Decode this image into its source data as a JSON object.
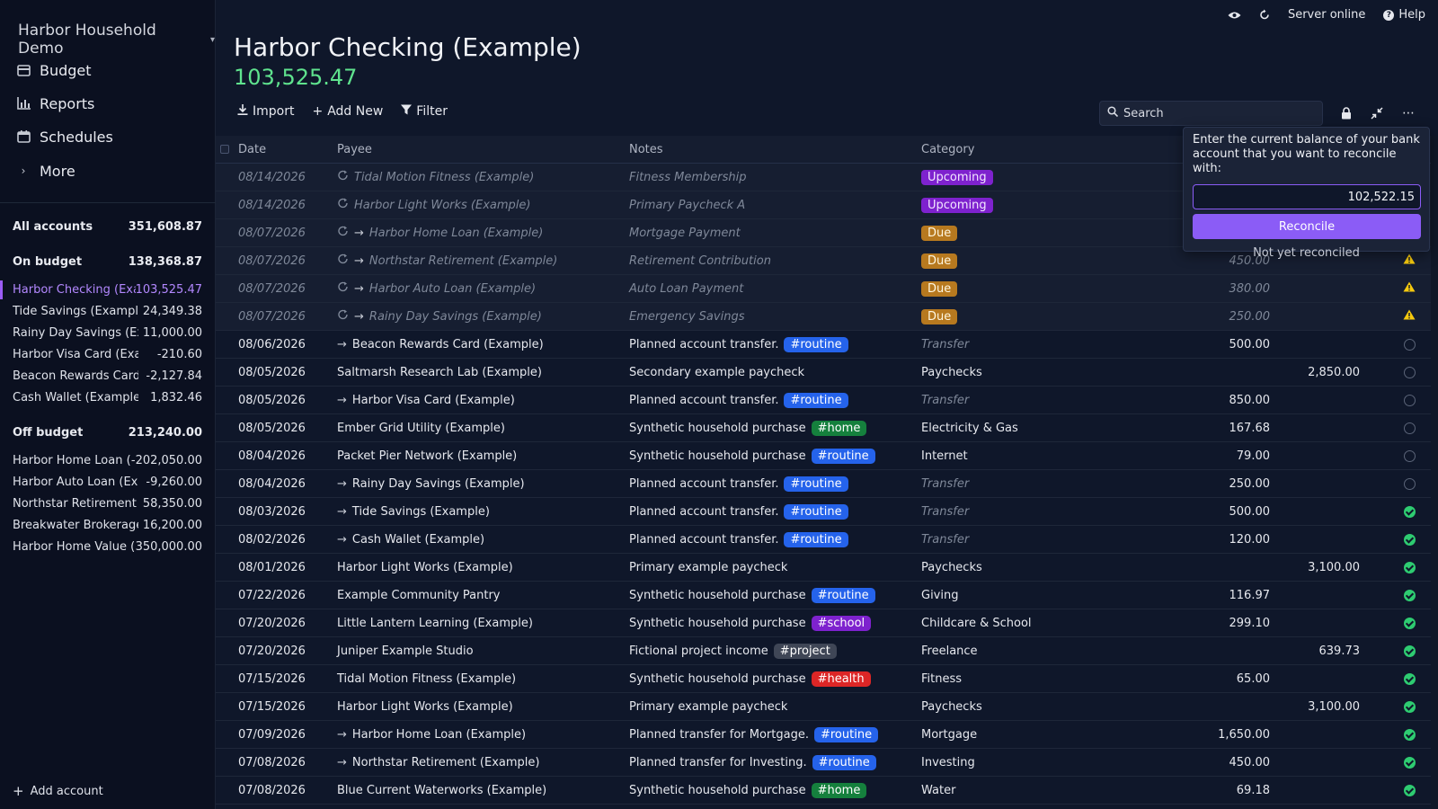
{
  "sidebar": {
    "budget_name": "Harbor Household Demo",
    "nav": [
      {
        "label": "Budget",
        "icon": "wallet-icon"
      },
      {
        "label": "Reports",
        "icon": "reports-icon"
      },
      {
        "label": "Schedules",
        "icon": "calendar-icon"
      },
      {
        "label": "More",
        "icon": "chevron-right-icon"
      }
    ],
    "all_accounts": {
      "label": "All accounts",
      "amount": "351,608.87"
    },
    "on_budget": {
      "label": "On budget",
      "amount": "138,368.87"
    },
    "on_budget_accounts": [
      {
        "name": "Harbor Checking (Example)",
        "amount": "103,525.47",
        "active": true
      },
      {
        "name": "Tide Savings (Example)",
        "amount": "24,349.38"
      },
      {
        "name": "Rainy Day Savings (Example)",
        "amount": "11,000.00"
      },
      {
        "name": "Harbor Visa Card (Example)",
        "amount": "-210.60"
      },
      {
        "name": "Beacon Rewards Card (Example)",
        "amount": "-2,127.84"
      },
      {
        "name": "Cash Wallet (Example)",
        "amount": "1,832.46"
      }
    ],
    "off_budget": {
      "label": "Off budget",
      "amount": "213,240.00"
    },
    "off_budget_accounts": [
      {
        "name": "Harbor Home Loan (Example)",
        "amount": "-202,050.00"
      },
      {
        "name": "Harbor Auto Loan (Example)",
        "amount": "-9,260.00"
      },
      {
        "name": "Northstar Retirement (Example)",
        "amount": "58,350.00"
      },
      {
        "name": "Breakwater Brokerage (Example)",
        "amount": "16,200.00"
      },
      {
        "name": "Harbor Home Value (Example)",
        "amount": "350,000.00"
      }
    ],
    "add_account": "Add account"
  },
  "topbar": {
    "server_status": "Server online",
    "help": "Help"
  },
  "account": {
    "title": "Harbor Checking (Example)",
    "balance": "103,525.47"
  },
  "toolbar": {
    "import": "Import",
    "add_new": "Add New",
    "filter": "Filter",
    "search_placeholder": "Search"
  },
  "columns": {
    "date": "Date",
    "payee": "Payee",
    "notes": "Notes",
    "category": "Category"
  },
  "colors": {
    "accent": "#8b5cf6",
    "balance_green": "#5fe38e",
    "upcoming": "#7e22ce",
    "due": "#b7791f",
    "cleared": "#2ecc71"
  },
  "transactions": [
    {
      "date": "08/14/2026",
      "payee": "Tidal Motion Fitness (Example)",
      "notes": "Fitness Membership",
      "status_badge": "Upcoming",
      "scheduled": true
    },
    {
      "date": "08/14/2026",
      "payee": "Harbor Light Works (Example)",
      "notes": "Primary Paycheck A",
      "status_badge": "Upcoming",
      "scheduled": true
    },
    {
      "date": "08/07/2026",
      "payee": "Harbor Home Loan (Example)",
      "transfer": true,
      "notes": "Mortgage Payment",
      "status_badge": "Due",
      "scheduled": true
    },
    {
      "date": "08/07/2026",
      "payee": "Northstar Retirement (Example)",
      "transfer": true,
      "notes": "Retirement Contribution",
      "status_badge": "Due",
      "payment": "450.00",
      "scheduled": true,
      "warn": true
    },
    {
      "date": "08/07/2026",
      "payee": "Harbor Auto Loan (Example)",
      "transfer": true,
      "notes": "Auto Loan Payment",
      "status_badge": "Due",
      "payment": "380.00",
      "scheduled": true,
      "warn": true
    },
    {
      "date": "08/07/2026",
      "payee": "Rainy Day Savings (Example)",
      "transfer": true,
      "notes": "Emergency Savings",
      "status_badge": "Due",
      "payment": "250.00",
      "scheduled": true,
      "warn": true
    },
    {
      "date": "08/06/2026",
      "payee": "Beacon Rewards Card (Example)",
      "transfer": true,
      "notes": "Planned account transfer.",
      "tag": "#routine",
      "category": "Transfer",
      "payment": "500.00",
      "status": "pending"
    },
    {
      "date": "08/05/2026",
      "payee": "Saltmarsh Research Lab (Example)",
      "notes": "Secondary example paycheck",
      "category": "Paychecks",
      "deposit": "2,850.00",
      "status": "pending"
    },
    {
      "date": "08/05/2026",
      "payee": "Harbor Visa Card (Example)",
      "transfer": true,
      "notes": "Planned account transfer.",
      "tag": "#routine",
      "category": "Transfer",
      "payment": "850.00",
      "status": "pending"
    },
    {
      "date": "08/05/2026",
      "payee": "Ember Grid Utility (Example)",
      "notes": "Synthetic household purchase",
      "tag": "#home",
      "category": "Electricity & Gas",
      "payment": "167.68",
      "status": "pending"
    },
    {
      "date": "08/04/2026",
      "payee": "Packet Pier Network (Example)",
      "notes": "Synthetic household purchase",
      "tag": "#routine",
      "category": "Internet",
      "payment": "79.00",
      "status": "pending"
    },
    {
      "date": "08/04/2026",
      "payee": "Rainy Day Savings (Example)",
      "transfer": true,
      "notes": "Planned account transfer.",
      "tag": "#routine",
      "category": "Transfer",
      "payment": "250.00",
      "status": "pending"
    },
    {
      "date": "08/03/2026",
      "payee": "Tide Savings (Example)",
      "transfer": true,
      "notes": "Planned account transfer.",
      "tag": "#routine",
      "category": "Transfer",
      "payment": "500.00",
      "status": "cleared"
    },
    {
      "date": "08/02/2026",
      "payee": "Cash Wallet (Example)",
      "transfer": true,
      "notes": "Planned account transfer.",
      "tag": "#routine",
      "category": "Transfer",
      "payment": "120.00",
      "status": "cleared"
    },
    {
      "date": "08/01/2026",
      "payee": "Harbor Light Works (Example)",
      "notes": "Primary example paycheck",
      "category": "Paychecks",
      "deposit": "3,100.00",
      "status": "cleared"
    },
    {
      "date": "07/22/2026",
      "payee": "Example Community Pantry",
      "notes": "Synthetic household purchase",
      "tag": "#routine",
      "category": "Giving",
      "payment": "116.97",
      "status": "cleared"
    },
    {
      "date": "07/20/2026",
      "payee": "Little Lantern Learning (Example)",
      "notes": "Synthetic household purchase",
      "tag": "#school",
      "category": "Childcare & School",
      "payment": "299.10",
      "status": "cleared"
    },
    {
      "date": "07/20/2026",
      "payee": "Juniper Example Studio",
      "notes": "Fictional project income",
      "tag": "#project",
      "category": "Freelance",
      "deposit": "639.73",
      "status": "cleared"
    },
    {
      "date": "07/15/2026",
      "payee": "Tidal Motion Fitness (Example)",
      "notes": "Synthetic household purchase",
      "tag": "#health",
      "category": "Fitness",
      "payment": "65.00",
      "status": "cleared"
    },
    {
      "date": "07/15/2026",
      "payee": "Harbor Light Works (Example)",
      "notes": "Primary example paycheck",
      "category": "Paychecks",
      "deposit": "3,100.00",
      "status": "cleared"
    },
    {
      "date": "07/09/2026",
      "payee": "Harbor Home Loan (Example)",
      "transfer": true,
      "notes": "Planned transfer for Mortgage.",
      "tag": "#routine",
      "category": "Mortgage",
      "payment": "1,650.00",
      "status": "cleared"
    },
    {
      "date": "07/08/2026",
      "payee": "Northstar Retirement (Example)",
      "transfer": true,
      "notes": "Planned transfer for Investing.",
      "tag": "#routine",
      "category": "Investing",
      "payment": "450.00",
      "status": "cleared"
    },
    {
      "date": "07/08/2026",
      "payee": "Blue Current Waterworks (Example)",
      "notes": "Synthetic household purchase",
      "tag": "#home",
      "category": "Water",
      "payment": "69.18",
      "status": "cleared"
    }
  ],
  "tag_colors": {
    "#routine": "#2563eb",
    "#home": "#15803d",
    "#school": "#7e22ce",
    "#project": "#3f4656",
    "#health": "#dc2626"
  },
  "reconcile": {
    "prompt": "Enter the current balance of your bank account that you want to reconcile with:",
    "value": "102,522.15",
    "button": "Reconcile",
    "link": "Not yet reconciled"
  }
}
